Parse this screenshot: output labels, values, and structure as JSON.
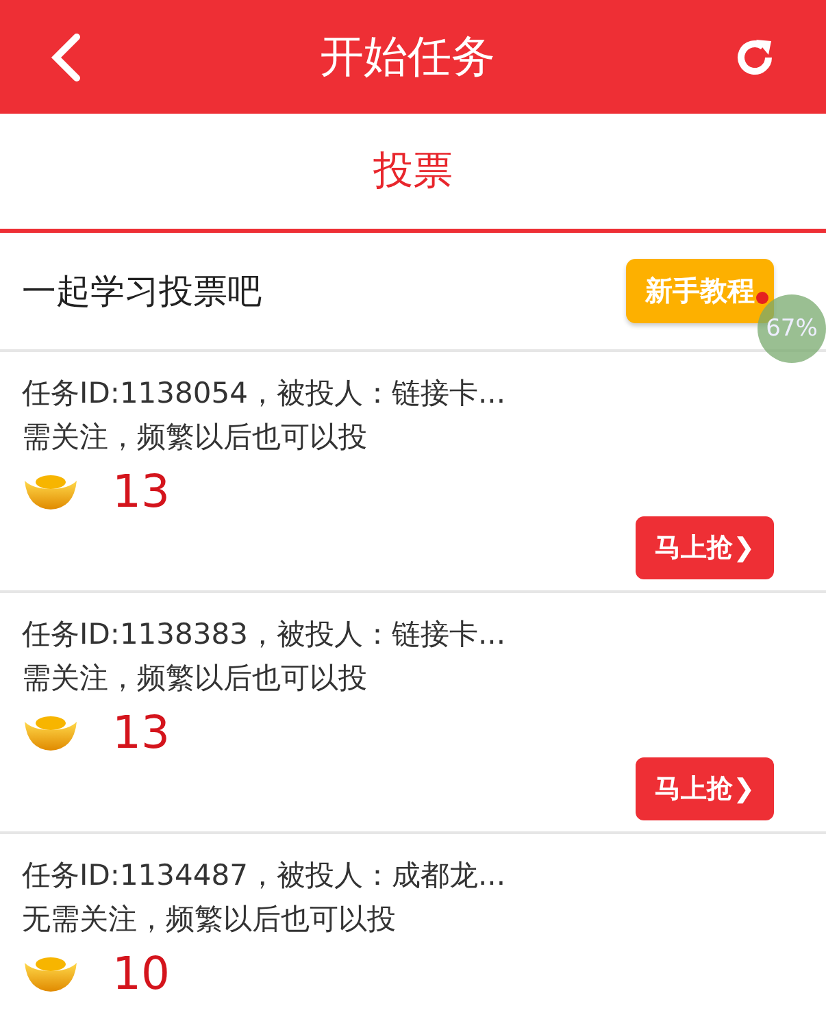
{
  "header": {
    "title": "开始任务"
  },
  "tabs": [
    {
      "label": "投票",
      "selected": true
    }
  ],
  "intro": {
    "text": "一起学习投票吧",
    "button": "新手教程",
    "notification_dot": true
  },
  "floating_ball": {
    "text": "67%"
  },
  "tasks": [
    {
      "title": "任务ID:1138054，被投人：链接卡...",
      "note": "需关注，频繁以后也可以投",
      "reward": "13",
      "button": "马上抢❯"
    },
    {
      "title": "任务ID:1138383，被投人：链接卡...",
      "note": "需关注，频繁以后也可以投",
      "reward": "13",
      "button": "马上抢❯"
    },
    {
      "title": "任务ID:1134487，被投人：成都龙...",
      "note": "无需关注，频繁以后也可以投",
      "reward": "10"
    }
  ]
}
